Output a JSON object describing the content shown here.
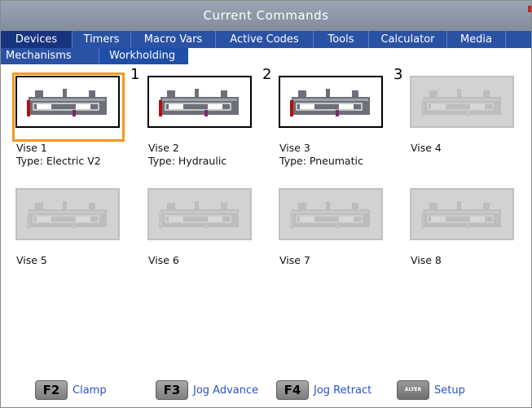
{
  "title": "Current Commands",
  "tabs": [
    {
      "label": "Devices",
      "active": true
    },
    {
      "label": "Timers",
      "active": false
    },
    {
      "label": "Macro Vars",
      "active": false
    },
    {
      "label": "Active Codes",
      "active": false
    },
    {
      "label": "Tools",
      "active": false
    },
    {
      "label": "Calculator",
      "active": false
    },
    {
      "label": "Media",
      "active": false
    }
  ],
  "subtabs": [
    {
      "label": "Mechanisms",
      "active": false
    },
    {
      "label": "Workholding",
      "active": true
    }
  ],
  "vises": [
    {
      "name": "Vise 1",
      "type": "Type: Electric V2",
      "number": "1",
      "configured": true,
      "selected": true
    },
    {
      "name": "Vise 2",
      "type": "Type: Hydraulic",
      "number": "2",
      "configured": true,
      "selected": false
    },
    {
      "name": "Vise 3",
      "type": "Type: Pneumatic",
      "number": "3",
      "configured": true,
      "selected": false
    },
    {
      "name": "Vise 4",
      "type": "",
      "number": "",
      "configured": false,
      "selected": false
    },
    {
      "name": "Vise 5",
      "type": "",
      "number": "",
      "configured": false,
      "selected": false
    },
    {
      "name": "Vise 6",
      "type": "",
      "number": "",
      "configured": false,
      "selected": false
    },
    {
      "name": "Vise 7",
      "type": "",
      "number": "",
      "configured": false,
      "selected": false
    },
    {
      "name": "Vise 8",
      "type": "",
      "number": "",
      "configured": false,
      "selected": false
    }
  ],
  "function_keys": [
    {
      "key": "F2",
      "label": "Clamp",
      "icon": "key-f2"
    },
    {
      "key": "F3",
      "label": "Jog Advance",
      "icon": "key-f3"
    },
    {
      "key": "F4",
      "label": "Jog Retract",
      "icon": "key-f4"
    },
    {
      "key": "ALTER",
      "label": "Setup",
      "icon": "key-alter"
    }
  ],
  "colors": {
    "title_bar": "#8a94a4",
    "tab_bar": "#2a52a4",
    "active_tab": "#18347e",
    "selection": "#f29a1e",
    "link": "#2a52c4"
  }
}
